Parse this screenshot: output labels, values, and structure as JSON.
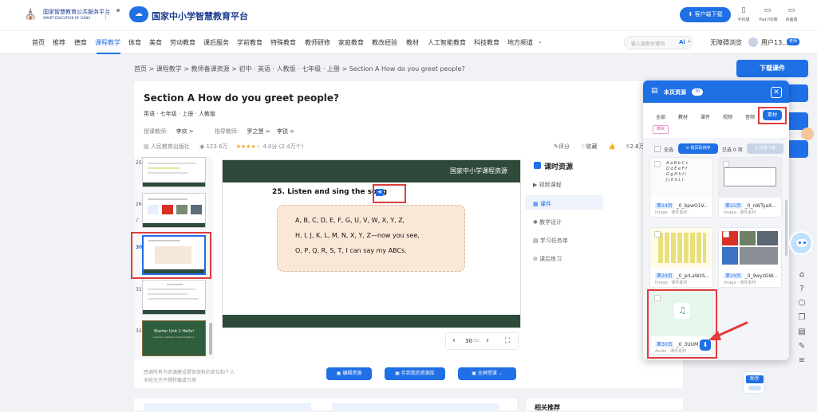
{
  "header": {
    "portal_name": "国家智慧教育公共服务平台",
    "portal_name_en": "SMART EDUCATION OF CHINA",
    "platform_name": "国家中小学智慧教育平台",
    "download_client": "客户端下载",
    "devices": [
      "手机版",
      "Pad HD版",
      "桌面版"
    ]
  },
  "nav": {
    "items": [
      "首页",
      "推荐",
      "德育",
      "课程教学",
      "体育",
      "美育",
      "劳动教育",
      "课后服务",
      "学前教育",
      "特殊教育",
      "教师研修",
      "家庭教育",
      "教改经验",
      "教材",
      "人工智能教育",
      "科技教育",
      "地方频道"
    ],
    "active": "课程教学",
    "search_placeholder": "输入搜索关键词",
    "ai_label": "Ai",
    "mode": "无障碍浏览",
    "user": "用户13...",
    "user_badge": "老师"
  },
  "breadcrumb": [
    "首页",
    "课程教学",
    "教师备课资源",
    "初中 · 英语 · 人教版 · 七年级 · 上册",
    "Section A How do you greet people?"
  ],
  "lesson": {
    "title": "Section A How do you greet people?",
    "meta": "英语 · 七年级 · 上册 · 人教版",
    "teacher_label": "授课教师:",
    "teacher": "李欢",
    "guide_label": "指导教师:",
    "guides": [
      "罗之慧",
      "李锐"
    ],
    "publisher": "人民教育出版社",
    "views": "123.6万",
    "rating": "4.0分",
    "rating_count": "(2.4万个)",
    "rating_value": 4,
    "actions": [
      "评分",
      "收藏",
      "2.8万"
    ]
  },
  "thumbs": {
    "numbers": [
      "25",
      "26",
      "30",
      "31",
      "32"
    ],
    "t32_title": "Starter Unit 1 Hello!",
    "t32_sub": "( Lesson 1 Section A Pronunciation )"
  },
  "slide": {
    "banner": "国家中小学课程资源",
    "heading": "25. Listen and sing the song",
    "lines": [
      "A, B, C, D, E, F, G,  U, V, W, X, Y, Z,",
      "H, I, J, K, L, M, N,  X, Y, Z—now you see,",
      "O, P, Q, R, S, T,   I can say my ABCs."
    ],
    "page_current": "30",
    "page_total": "/32"
  },
  "resources": {
    "title": "课时资源",
    "items": [
      "视频课程",
      "课件",
      "教学设计",
      "学习任务单",
      "课后练习"
    ],
    "active": "课件"
  },
  "footer": {
    "note1": "感谢所有为资源建设提供资料的单位和个人",
    "note2": "未经允许不得转载或引用",
    "btn_edit": "编辑资源",
    "btn_save": "存到我的资源库",
    "btn_sync": "全屏授课"
  },
  "right": {
    "download_courseware": "下载课件",
    "related": "相关推荐"
  },
  "panel": {
    "title": "本页资源",
    "count": "30",
    "filters": [
      "全部",
      "教材",
      "课件",
      "视频",
      "音频",
      "素材"
    ],
    "active_filter": "素材",
    "sub_tag": "微资",
    "select_all": "全选",
    "sort": "按页码排序",
    "selected": "已选 0 项",
    "batch_download": "批量下载",
    "cards": [
      {
        "page": "第24页",
        "name": "_0_bpwO1V...",
        "type": "Image · 课件素材"
      },
      {
        "page": "第25页",
        "name": "_0_nWTyaX...",
        "type": "Image · 课件素材"
      },
      {
        "page": "第29页",
        "name": "_0_prLaWzS...",
        "type": "Image · 课件素材"
      },
      {
        "page": "第29页",
        "name": "_0_9wyzGW...",
        "type": "Image · 课件素材"
      },
      {
        "page": "第30页",
        "name": "_0_3UUM...",
        "type": "Audio · 课件素材"
      }
    ]
  },
  "assistant": {
    "label": "助手"
  },
  "colors": {
    "brand": "#1f6fe5",
    "highlight": "#e03c3c",
    "slide_dark": "#2e4a3a"
  }
}
